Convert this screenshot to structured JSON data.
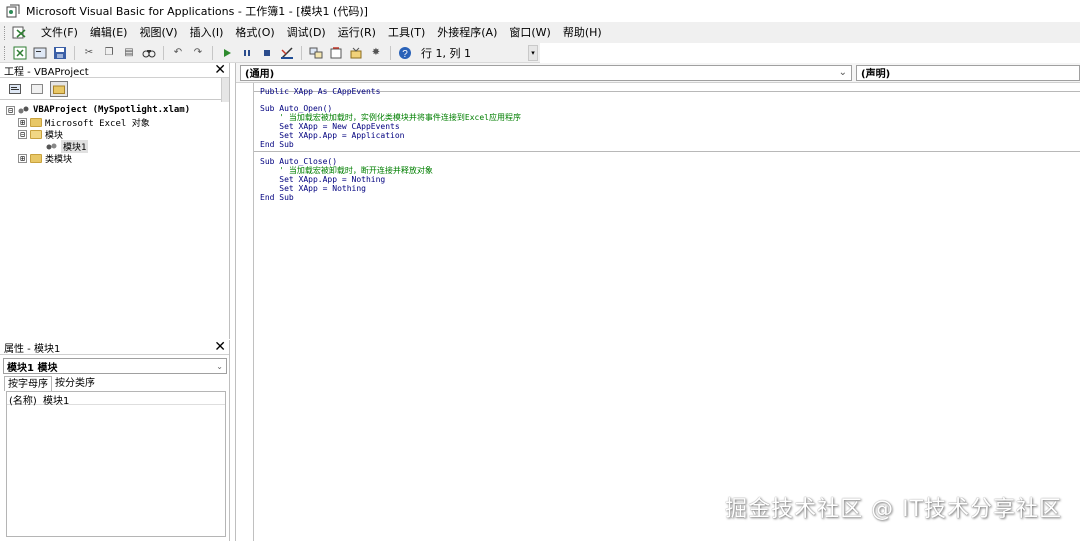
{
  "window": {
    "title": "Microsoft Visual Basic for Applications - 工作簿1 - [模块1 (代码)]"
  },
  "menu": {
    "items": [
      "文件(F)",
      "编辑(E)",
      "视图(V)",
      "插入(I)",
      "格式(O)",
      "调试(D)",
      "运行(R)",
      "工具(T)",
      "外接程序(A)",
      "窗口(W)",
      "帮助(H)"
    ]
  },
  "toolbar": {
    "position": "行 1, 列 1"
  },
  "project_pane": {
    "title": "工程 - VBAProject",
    "close": "✕",
    "tree": [
      {
        "label": "VBAProject (MySpotlight.xlam)",
        "bold": true,
        "expander": "⊟",
        "icon": "vba-project-icon"
      },
      {
        "label": "Microsoft Excel 对象",
        "expander": "⊞",
        "icon": "folder-icon"
      },
      {
        "label": "模块",
        "expander": "⊟",
        "icon": "folder-open-icon"
      },
      {
        "label": "模块1",
        "icon": "module-icon",
        "selected": true
      },
      {
        "label": "类模块",
        "expander": "⊞",
        "icon": "folder-icon"
      }
    ]
  },
  "properties_pane": {
    "title": "属性 - 模块1",
    "close": "✕",
    "object_combo": "模块1 模块",
    "tabs": [
      "按字母序",
      "按分类序"
    ],
    "rows": [
      {
        "name": "(名称)",
        "value": "模块1"
      }
    ]
  },
  "code_window": {
    "object_combo": "(通用)",
    "proc_combo": "(声明)",
    "lines": [
      {
        "text": "Public XApp As CAppEvents",
        "kind": "kw"
      },
      {
        "text": "",
        "kind": "sep"
      },
      {
        "text": "Sub Auto_Open()",
        "kind": "kw"
      },
      {
        "text": "    ' 当加载宏被加载时，实例化类模块并将事件连接到Excel应用程序",
        "kind": "comment"
      },
      {
        "text": "    Set XApp = New CAppEvents",
        "kind": "kw"
      },
      {
        "text": "    Set XApp.App = Application",
        "kind": "kw"
      },
      {
        "text": "End Sub",
        "kind": "kw"
      },
      {
        "text": "",
        "kind": "sep"
      },
      {
        "text": "Sub Auto_Close()",
        "kind": "kw"
      },
      {
        "text": "    ' 当加载宏被卸载时，断开连接并释放对象",
        "kind": "comment"
      },
      {
        "text": "    Set XApp.App = Nothing",
        "kind": "kw"
      },
      {
        "text": "    Set XApp = Nothing",
        "kind": "kw"
      },
      {
        "text": "End Sub",
        "kind": "kw"
      }
    ]
  },
  "watermark": "掘金技术社区 @ IT技术分享社区",
  "colors": {
    "keyword": "#00007f",
    "comment": "#007f00",
    "folder": "#e8c766"
  }
}
